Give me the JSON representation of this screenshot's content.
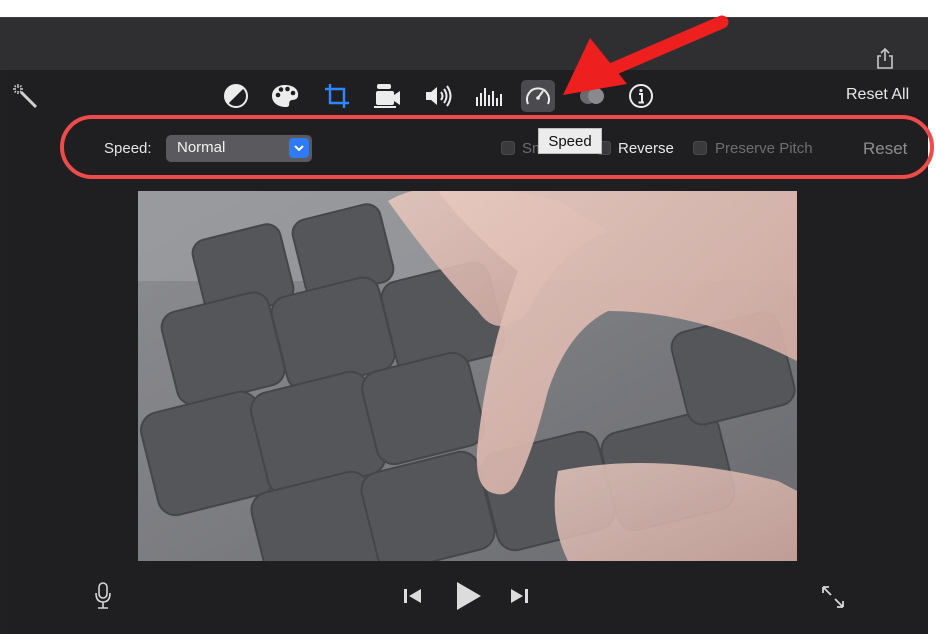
{
  "toolbar": {
    "tools": [
      {
        "name": "color-balance-icon"
      },
      {
        "name": "color-correction-icon"
      },
      {
        "name": "crop-icon"
      },
      {
        "name": "stabilization-icon"
      },
      {
        "name": "volume-icon"
      },
      {
        "name": "noise-reduction-icon"
      },
      {
        "name": "speedometer-icon",
        "active": true
      },
      {
        "name": "clip-filter-icon"
      },
      {
        "name": "clip-info-icon"
      }
    ],
    "reset_all_label": "Reset All"
  },
  "speed_controls": {
    "speed_label": "Speed:",
    "speed_value": "Normal",
    "smooth_label": "Sm",
    "reverse_label": "Reverse",
    "preserve_pitch_label": "Preserve Pitch",
    "reset_label": "Reset"
  },
  "tooltip": {
    "text": "Speed"
  },
  "annotation": {
    "color": "#ef4b4b"
  },
  "viewer": {
    "description_icons": [
      "microphone-icon",
      "skip-back-icon",
      "play-icon",
      "skip-forward-icon",
      "fullscreen-icon"
    ]
  },
  "colors": {
    "accent": "#2f7bf6",
    "panel": "#1f1f21"
  }
}
